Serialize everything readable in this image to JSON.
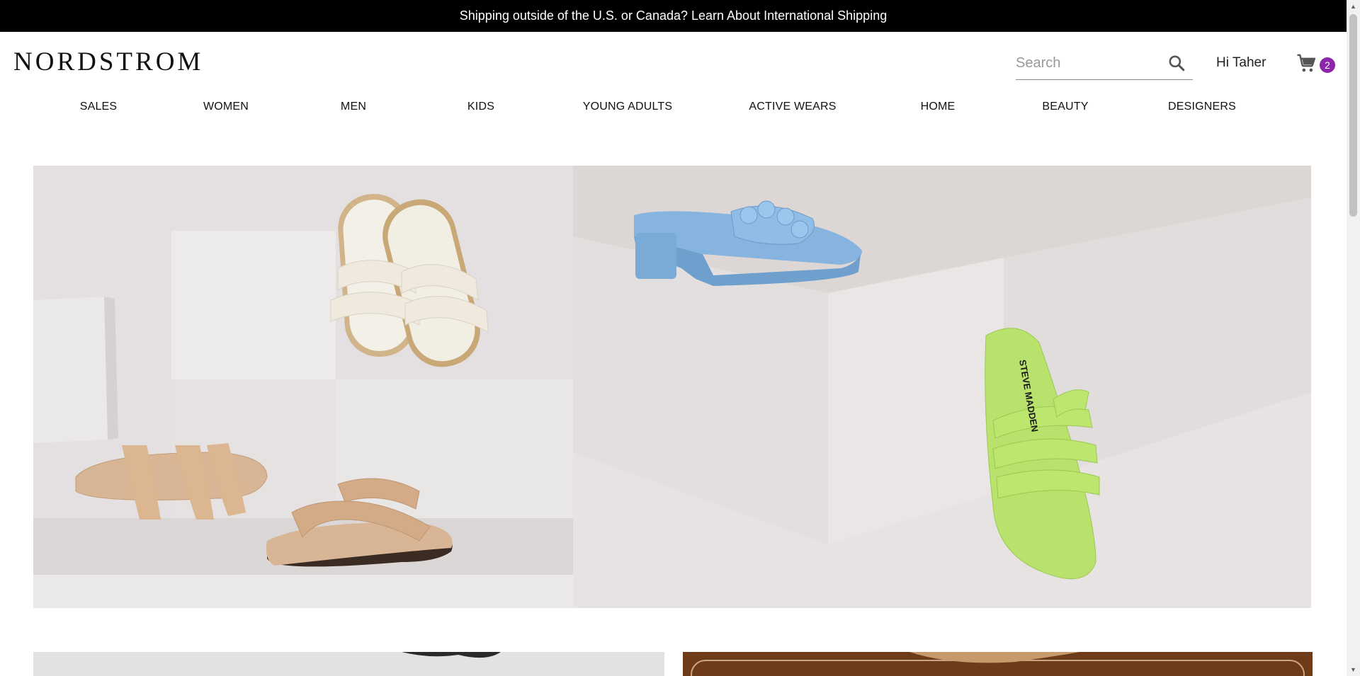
{
  "promo": {
    "text": "Shipping outside of the U.S. or Canada? Learn About International Shipping"
  },
  "header": {
    "logo": "NORDSTROM",
    "search_placeholder": "Search",
    "greeting": "Hi Taher",
    "cart_count": "2"
  },
  "nav": {
    "items": [
      {
        "label": "SALES"
      },
      {
        "label": "WOMEN"
      },
      {
        "label": "MEN"
      },
      {
        "label": "KIDS"
      },
      {
        "label": "YOUNG ADULTS"
      },
      {
        "label": "ACTIVE WEARS"
      },
      {
        "label": "HOME"
      },
      {
        "label": "BEAUTY"
      },
      {
        "label": "DESIGNERS"
      }
    ]
  },
  "hero": {
    "sandal_brand": "STEVE MADDEN"
  },
  "icons": {
    "search": "search-icon",
    "cart": "cart-icon"
  },
  "colors": {
    "promo_bg": "#000000",
    "badge": "#8e24aa",
    "hero_bg": "#e6e2e2",
    "blue_sandal": "#7fb0dc",
    "green_sandal": "#b5e06a",
    "tan_sandal": "#d9b18f"
  }
}
